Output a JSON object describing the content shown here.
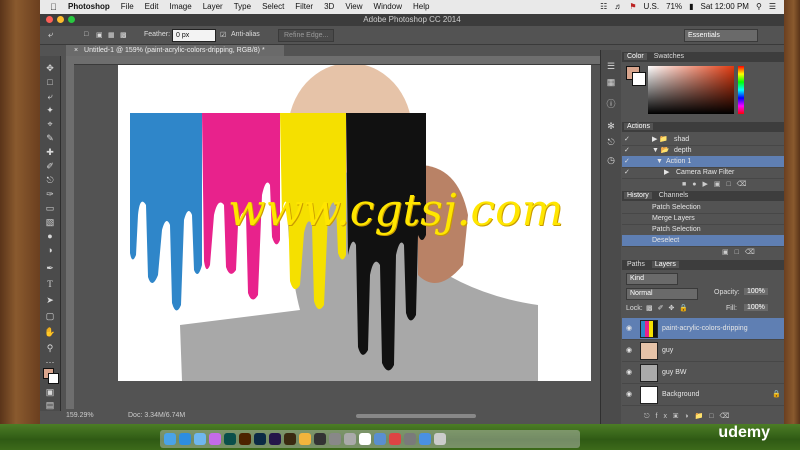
{
  "menubar": {
    "app": "Photoshop",
    "items": [
      "File",
      "Edit",
      "Image",
      "Layer",
      "Type",
      "Select",
      "Filter",
      "3D",
      "View",
      "Window",
      "Help"
    ],
    "flag": "U.S.",
    "battery": "71%",
    "clock": "Sat 12:00 PM"
  },
  "titlebar": {
    "title": "Adobe Photoshop CC 2014"
  },
  "options": {
    "feather_label": "Feather:",
    "feather_value": "0 px",
    "antialias_label": "Anti-alias",
    "refine_label": "Refine Edge...",
    "workspace": "Essentials"
  },
  "document": {
    "tab": "Untitled-1 @ 159% (paint-acrylic-colors-dripping, RGB/8) *",
    "zoom": "159.29%",
    "doc_size": "Doc: 3.34M/6.74M",
    "watermark": "www.cgtsj.com"
  },
  "color_panel": {
    "tabs": [
      "Color",
      "Swatches"
    ]
  },
  "actions_panel": {
    "title": "Actions",
    "items": [
      "shad",
      "depth",
      "Action 1",
      "Camera Raw Filter"
    ]
  },
  "history_panel": {
    "tabs": [
      "History",
      "Channels"
    ],
    "items": [
      "Patch Selection",
      "Merge Layers",
      "Patch Selection",
      "Deselect"
    ]
  },
  "layers_panel": {
    "tabs": [
      "Paths",
      "Layers"
    ],
    "kind": "Kind",
    "blend": "Normal",
    "opacity_label": "Opacity:",
    "opacity": "100%",
    "lock_label": "Lock:",
    "fill_label": "Fill:",
    "fill": "100%",
    "layers": [
      "paint-acrylic-colors-dripping",
      "guy",
      "guy BW",
      "Background"
    ]
  },
  "branding": {
    "udemy": "udemy"
  }
}
